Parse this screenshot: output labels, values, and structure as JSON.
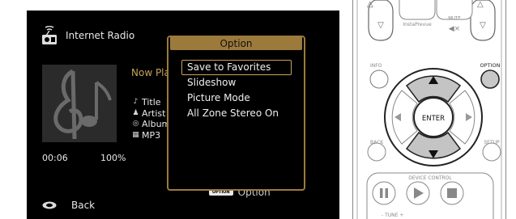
{
  "header": {
    "title": "Internet Radio",
    "icon": "radio-icon"
  },
  "now_playing": {
    "label": "Now Playing"
  },
  "track": {
    "title": "Title",
    "artist": "Artist",
    "album": "Album",
    "format": "MP3"
  },
  "playback": {
    "time": "00:06",
    "buffer": "100%"
  },
  "footer": {
    "back_label": "Back",
    "option_key": "OPTION",
    "option_label": "Option"
  },
  "option_menu": {
    "title": "Option",
    "items": [
      "Save to Favorites",
      "Slideshow",
      "Picture Mode",
      "All Zone Stereo On"
    ],
    "selected_index": 0
  },
  "remote": {
    "top_labels": [
      "InstaPrevue",
      "MUTE"
    ],
    "info_label": "INFO",
    "option_label": "OPTION",
    "enter_label": "ENTER",
    "back_label": "BACK",
    "setup_label": "SETUP",
    "device_control_label": "DEVICE CONTROL",
    "tune_label": "-  TUNE  +"
  },
  "colors": {
    "accent": "#9c7a3c",
    "highlight": "#c8a35a",
    "screen_bg": "#000000"
  }
}
